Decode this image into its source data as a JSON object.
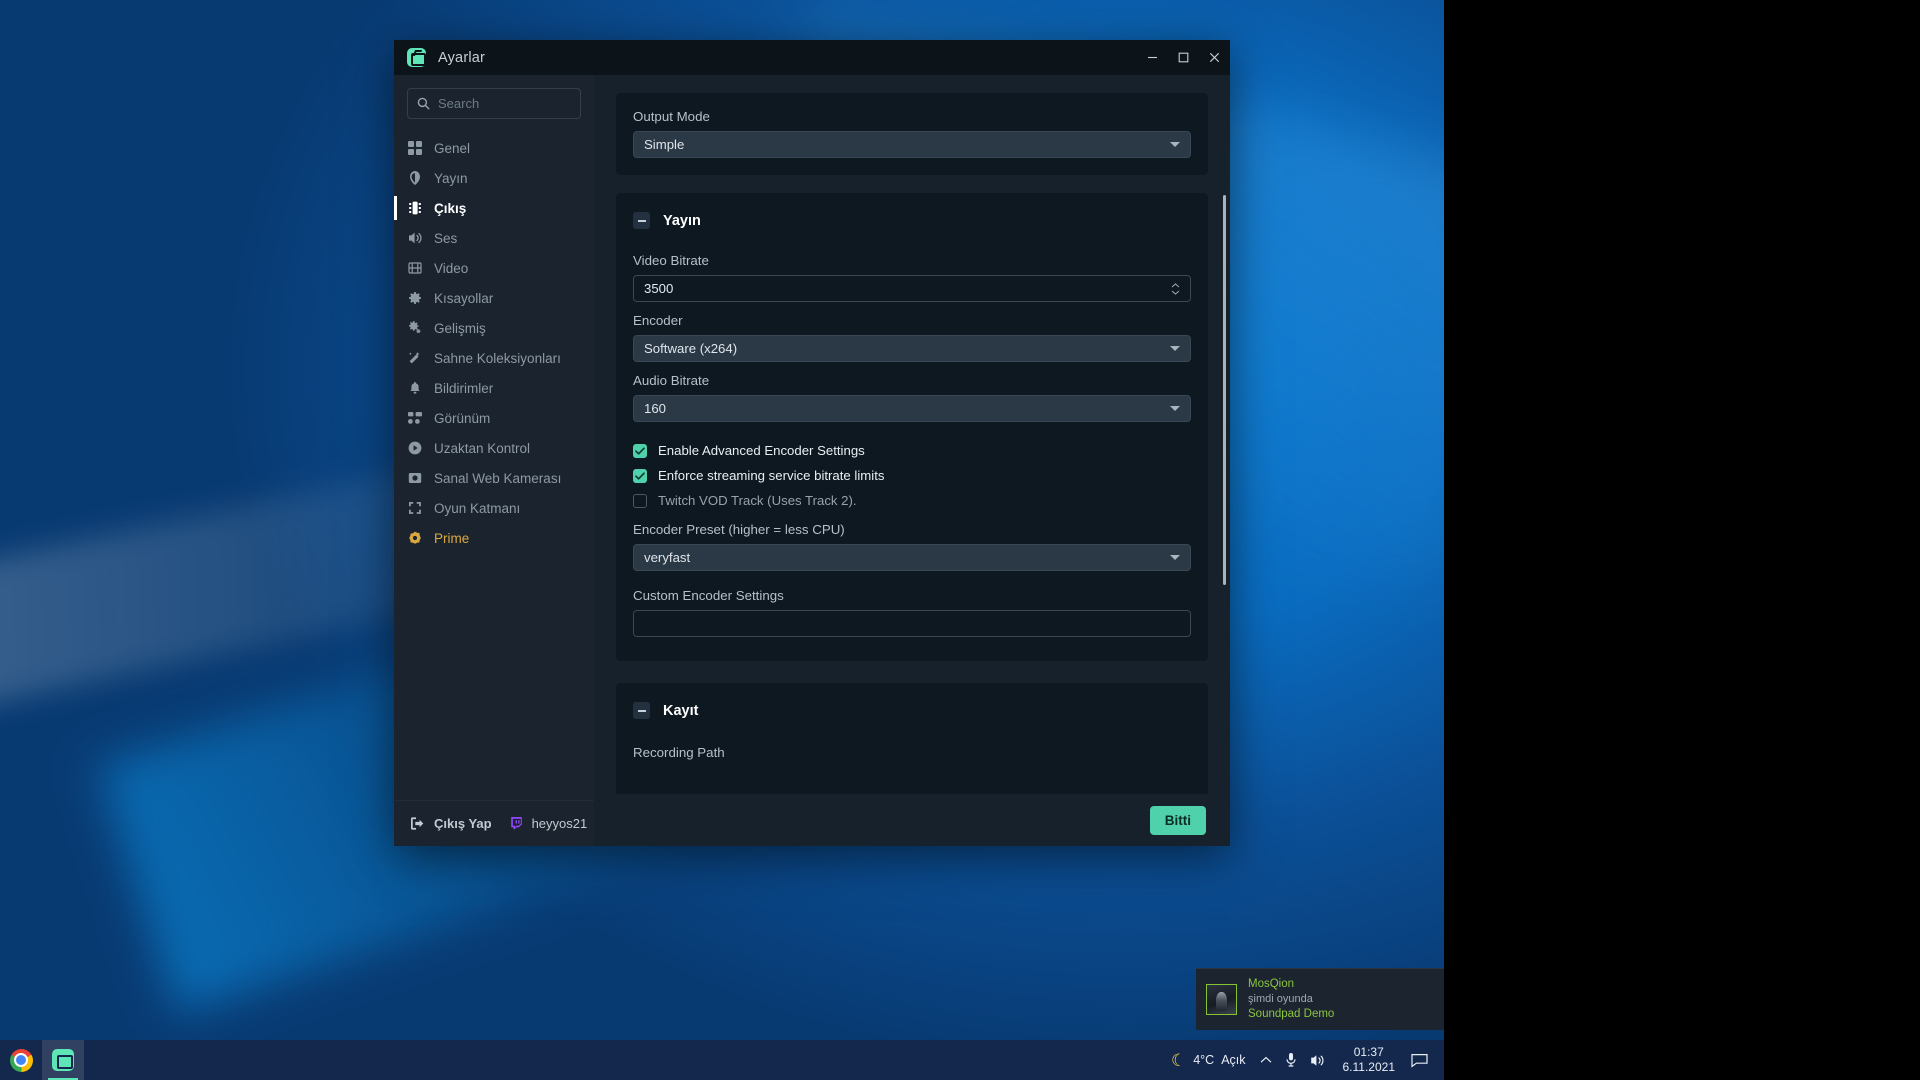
{
  "window": {
    "title": "Ayarlar",
    "app_icon": "streamlabs-icon",
    "controls": {
      "minimize": "minimize-icon",
      "maximize": "maximize-icon",
      "close": "close-icon"
    }
  },
  "sidebar": {
    "search": {
      "placeholder": "Search",
      "value": "",
      "icon": "search-icon"
    },
    "items": [
      {
        "label": "Genel",
        "icon": "grid-icon",
        "active": false
      },
      {
        "label": "Yayın",
        "icon": "broadcast-icon",
        "active": false
      },
      {
        "label": "Çıkış",
        "icon": "output-icon",
        "active": true
      },
      {
        "label": "Ses",
        "icon": "speaker-icon",
        "active": false
      },
      {
        "label": "Video",
        "icon": "film-icon",
        "active": false
      },
      {
        "label": "Kısayollar",
        "icon": "gear-icon",
        "active": false
      },
      {
        "label": "Gelişmiş",
        "icon": "gears-icon",
        "active": false
      },
      {
        "label": "Sahne Koleksiyonları",
        "icon": "magic-wand-icon",
        "active": false
      },
      {
        "label": "Bildirimler",
        "icon": "bell-icon",
        "active": false
      },
      {
        "label": "Görünüm",
        "icon": "layout-icon",
        "active": false
      },
      {
        "label": "Uzaktan Kontrol",
        "icon": "play-circle-icon",
        "active": false
      },
      {
        "label": "Sanal Web Kamerası",
        "icon": "camera-icon",
        "active": false
      },
      {
        "label": "Oyun Katmanı",
        "icon": "expand-icon",
        "active": false
      },
      {
        "label": "Prime",
        "icon": "prime-icon",
        "active": false
      }
    ],
    "footer": {
      "logout_label": "Çıkış Yap",
      "logout_icon": "logout-icon",
      "platform_icon": "twitch-icon",
      "username": "heyyos21"
    }
  },
  "content": {
    "output_mode": {
      "label": "Output Mode",
      "value": "Simple"
    },
    "stream_section": {
      "title": "Yayın",
      "collapse_icon": "minus-icon",
      "video_bitrate": {
        "label": "Video Bitrate",
        "value": "3500"
      },
      "encoder": {
        "label": "Encoder",
        "value": "Software (x264)"
      },
      "audio_bitrate": {
        "label": "Audio Bitrate",
        "value": "160"
      },
      "checkboxes": [
        {
          "label": "Enable Advanced Encoder Settings",
          "checked": true
        },
        {
          "label": "Enforce streaming service bitrate limits",
          "checked": true
        },
        {
          "label": "Twitch VOD Track (Uses Track 2).",
          "checked": false
        }
      ],
      "encoder_preset": {
        "label": "Encoder Preset (higher = less CPU)",
        "value": "veryfast"
      },
      "custom_encoder": {
        "label": "Custom Encoder Settings",
        "value": ""
      }
    },
    "recording_section": {
      "title": "Kayıt",
      "collapse_icon": "minus-icon",
      "recording_path_label": "Recording Path"
    },
    "done_button": "Bitti"
  },
  "toast": {
    "title": "MosQion",
    "subtitle": "şimdi oyunda",
    "game": "Soundpad Demo",
    "thumbnail": "game-thumbnail"
  },
  "taskbar": {
    "apps": [
      {
        "name": "chrome",
        "icon": "chrome-icon",
        "active": false
      },
      {
        "name": "streamlabs",
        "icon": "streamlabs-icon",
        "active": true
      }
    ],
    "weather": {
      "icon": "moon-icon",
      "temperature": "4°C",
      "condition": "Açık"
    },
    "tray": {
      "chevron": "chevron-up-icon",
      "mic": "microphone-icon",
      "volume": "volume-icon"
    },
    "clock": {
      "time": "01:37",
      "date": "6.11.2021"
    },
    "action_center": "notification-icon"
  },
  "colors": {
    "accent_mint": "#4fd1ab",
    "prime_gold": "#d9a93f",
    "twitch_purple": "#9147ff",
    "steam_green": "#8bc53f"
  }
}
